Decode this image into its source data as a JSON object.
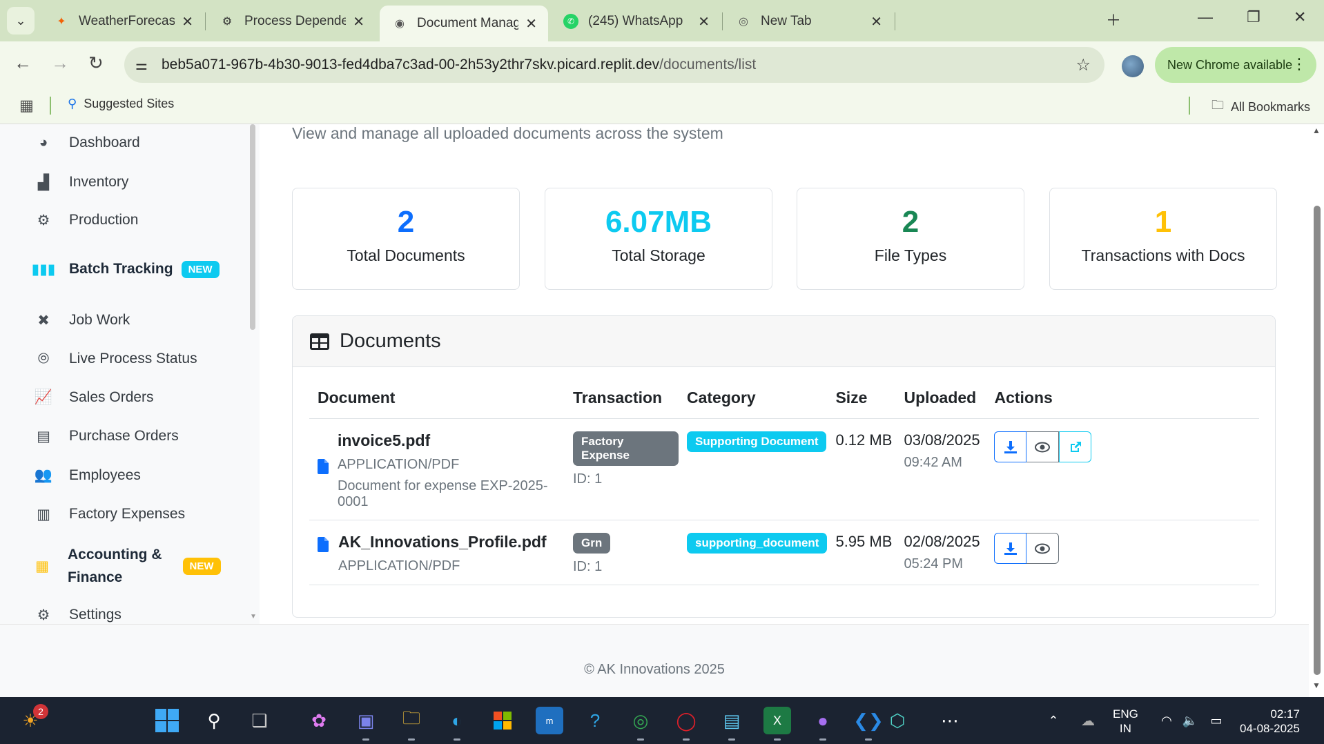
{
  "browser": {
    "tabs": [
      {
        "title": "WeatherForecast - Replit",
        "active": false
      },
      {
        "title": "Process Dependencies O",
        "active": false
      },
      {
        "title": "Document Management",
        "active": true
      },
      {
        "title": "(245) WhatsApp",
        "active": false
      },
      {
        "title": "New Tab",
        "active": false
      }
    ],
    "url_host": "beb5a071-967b-4b30-9013-fed4dba7c3ad-00-2h53y2thr7skv.picard.replit.dev",
    "url_path": "/documents/list",
    "update_label": "New Chrome available",
    "bookmarks": {
      "suggested": "Suggested Sites",
      "all": "All Bookmarks"
    }
  },
  "sidebar": {
    "items": [
      {
        "label": "Dashboard",
        "icon": "palette-icon"
      },
      {
        "label": "Inventory",
        "icon": "boxes-icon"
      },
      {
        "label": "Production",
        "icon": "gears-icon"
      },
      {
        "label": "Batch Tracking",
        "icon": "barcode-icon",
        "badge": "NEW"
      },
      {
        "label": "Job Work",
        "icon": "tools-icon"
      },
      {
        "label": "Live Process Status",
        "icon": "broadcast-icon"
      },
      {
        "label": "Sales Orders",
        "icon": "chart-line-icon"
      },
      {
        "label": "Purchase Orders",
        "icon": "file-invoice-icon"
      },
      {
        "label": "Employees",
        "icon": "users-icon"
      },
      {
        "label": "Factory Expenses",
        "icon": "receipt-icon"
      },
      {
        "label_line1": "Accounting &",
        "label_line2": "Finance",
        "icon": "calculator-icon",
        "badge": "NEW"
      },
      {
        "label": "Settings",
        "icon": "gear-icon"
      }
    ]
  },
  "main": {
    "subtitle": "View and manage all uploaded documents across the system",
    "stats": [
      {
        "value": "2",
        "label": "Total Documents",
        "color": "#0d6efd"
      },
      {
        "value": "6.07MB",
        "label": "Total Storage",
        "color": "#0dcaf0"
      },
      {
        "value": "2",
        "label": "File Types",
        "color": "#198754"
      },
      {
        "value": "1",
        "label": "Transactions with Docs",
        "color": "#ffc107"
      }
    ],
    "documents": {
      "title": "Documents",
      "columns": [
        "Document",
        "Transaction",
        "Category",
        "Size",
        "Uploaded",
        "Actions"
      ],
      "rows": [
        {
          "name": "invoice5.pdf",
          "mime": "APPLICATION/PDF",
          "description": "Document for expense EXP-2025-0001",
          "transaction": "Factory Expense",
          "transaction_id": "ID: 1",
          "category": "Supporting Document",
          "size": "0.12 MB",
          "date": "03/08/2025",
          "time": "09:42 AM"
        },
        {
          "name": "AK_Innovations_Profile.pdf",
          "mime": "APPLICATION/PDF",
          "transaction": "Grn",
          "transaction_id": "ID: 1",
          "category": "supporting_document",
          "size": "5.95 MB",
          "date": "02/08/2025",
          "time": "05:24 PM"
        }
      ]
    }
  },
  "footer": {
    "text": "© AK Innovations 2025"
  },
  "taskbar": {
    "notification_count": "2",
    "lang_line1": "ENG",
    "lang_line2": "IN",
    "time": "02:17",
    "date": "04-08-2025"
  },
  "colors": {
    "accent": "#0d6efd",
    "info": "#0dcaf0",
    "success": "#198754",
    "warning": "#ffc107"
  }
}
